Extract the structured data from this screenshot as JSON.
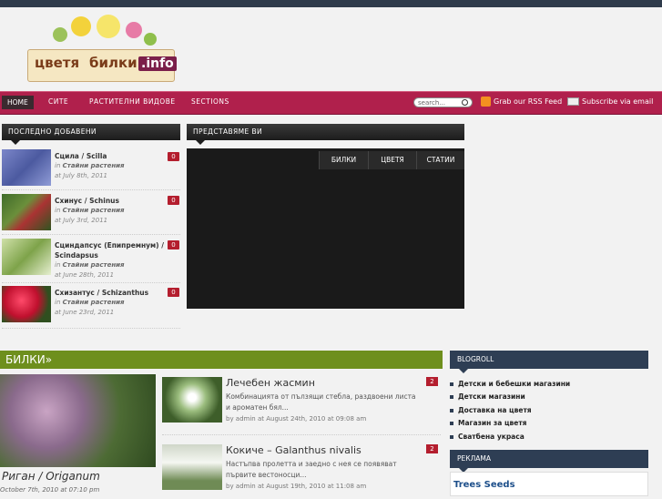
{
  "logo": {
    "text1": "цветя",
    "text2": "билки",
    "text3": ".info"
  },
  "nav": {
    "home": "HOME",
    "items": [
      "СИТЕ",
      "РАСТИТЕЛНИ ВИДОВЕ",
      "SECTIONS"
    ],
    "search_placeholder": "search...",
    "rss": "Grab our RSS Feed",
    "subscribe": "Subscribe via email"
  },
  "recent": {
    "heading": "ПОСЛЕДНО ДОБАВЕНИ",
    "items": [
      {
        "title": "Сцила / Scilla",
        "in": "in",
        "category": "Стайни растения",
        "date": "at July 8th, 2011",
        "comments": "0"
      },
      {
        "title": "Схинус / Schinus",
        "in": "in",
        "category": "Стайни растения",
        "date": "at July 3rd, 2011",
        "comments": "0"
      },
      {
        "title": "Сциндапсус (Епипремнум) / Scindapsus",
        "in": "in",
        "category": "Стайни растения",
        "date": "at June 28th, 2011",
        "comments": "0"
      },
      {
        "title": "Схизантус / Schizanthus",
        "in": "in",
        "category": "Стайни растения",
        "date": "at June 23rd, 2011",
        "comments": "0"
      }
    ]
  },
  "featured": {
    "heading": "ПРЕДСТАВЯМЕ ВИ",
    "tabs": [
      "БИЛКИ",
      "ЦВЕТЯ",
      "СТАТИИ"
    ]
  },
  "bilki": {
    "heading": "БИЛКИ»",
    "main_title": "Риган / Origanum",
    "main_date": "October 7th, 2010 at 07:10 pm",
    "posts": [
      {
        "title": "Лечебен жасмин",
        "excerpt": "Комбинацията от пълзящи стебла, раздвоени листа и ароматен бял...",
        "by": "by admin at August 24th, 2010 at 09:08 am",
        "comments": "2"
      },
      {
        "title": "Кокиче – Galanthus nivalis",
        "excerpt": "Настъпва пролетта и заедно с нея се появяват първите вестоносци...",
        "by": "by admin at August 19th, 2010 at 11:08 am",
        "comments": "2"
      }
    ]
  },
  "sidebar": {
    "blogroll_heading": "BLOGROLL",
    "blogroll": [
      "Детски и бебешки магазини",
      "Детски магазини",
      "Доставка на цветя",
      "Магазин за цветя",
      "Сватбена украса"
    ],
    "ads_heading": "РЕКЛАМА",
    "ad_title": "Trees Seeds"
  }
}
